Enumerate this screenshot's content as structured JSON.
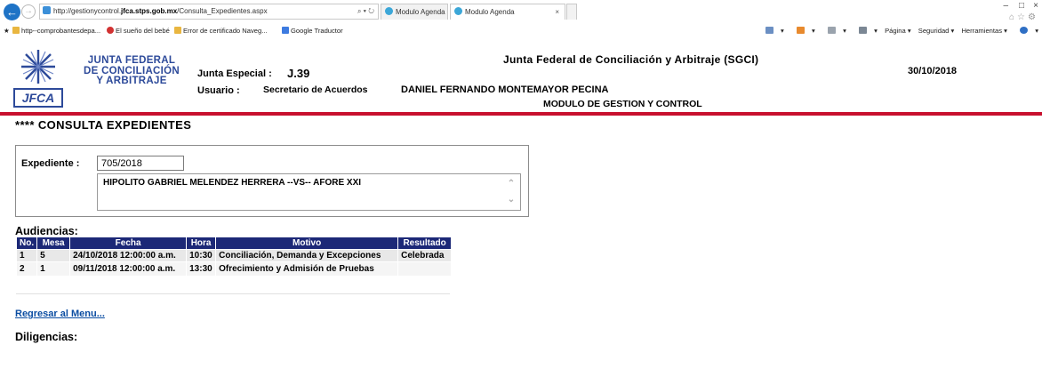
{
  "browser": {
    "address": {
      "prefix": "http://gestionycontrol.",
      "host": "jfca.stps.gob.mx",
      "path": "/Consulta_Expedientes.aspx",
      "tools": "⌕ ▾ ↻"
    },
    "tabs": [
      {
        "label": "Modulo Agenda"
      },
      {
        "label": "Modulo Agenda",
        "close": "×"
      }
    ],
    "window_controls": {
      "minimize": "–",
      "maximize": "□",
      "close": "×"
    },
    "right_icons": "⌂☆⚙",
    "favorites": [
      {
        "label": "http--comprobantesdepa...",
        "icon": "page-icon",
        "color": "#e9b640"
      },
      {
        "label": "El sueño del bebé",
        "icon": "red-dot-icon",
        "color": "#d23232"
      },
      {
        "label": "Error de certificado Naveg...",
        "icon": "page-icon",
        "color": "#e9b640"
      },
      {
        "label": "Google Traductor",
        "icon": "translate-icon",
        "color": "#3d7be0"
      }
    ],
    "command_bar": {
      "home": "▾",
      "feeds": "▾",
      "mail": "▾",
      "print": "▾",
      "page": "Página ▾",
      "security": "Seguridad ▾",
      "tools": "Herramientas ▾",
      "help": "▾"
    }
  },
  "header": {
    "logo_lines": [
      "JUNTA FEDERAL",
      "DE CONCILIACIÓN",
      "Y ARBITRAJE"
    ],
    "logo_badge": "JFCA",
    "org_title": "Junta Federal de Conciliación y Arbitraje (SGCI)",
    "date": "30/10/2018",
    "junta_label": "Junta Especial :",
    "junta_value": "J.39",
    "usuario_label": "Usuario :",
    "usuario_role": "Secretario de Acuerdos",
    "usuario_name": "DANIEL FERNANDO MONTEMAYOR PECINA",
    "module": "MODULO DE GESTION Y CONTROL"
  },
  "page_title": "**** CONSULTA EXPEDIENTES",
  "expediente": {
    "label": "Expediente :",
    "value": "705/2018",
    "partes": "HIPOLITO GABRIEL MELENDEZ HERRERA --VS-- AFORE XXI"
  },
  "audiencias": {
    "title": "Audiencias:",
    "columns": [
      "No.",
      "Mesa",
      "Fecha",
      "Hora",
      "Motivo",
      "Resultado"
    ],
    "rows": [
      [
        "1",
        "5",
        "24/10/2018 12:00:00 a.m.",
        "10:30",
        "Conciliación, Demanda y Excepciones",
        "Celebrada"
      ],
      [
        "2",
        "1",
        "09/11/2018 12:00:00 a.m.",
        "13:30",
        "Ofrecimiento y Admisión de Pruebas",
        ""
      ]
    ]
  },
  "links": {
    "back_to_menu": "Regresar al Menu..."
  },
  "diligencias": {
    "title": "Diligencias:"
  },
  "colors": {
    "accent_red": "#c8102e",
    "table_header": "#1c2877",
    "link": "#0b4da2",
    "logo_blue": "#2d4a9a"
  }
}
